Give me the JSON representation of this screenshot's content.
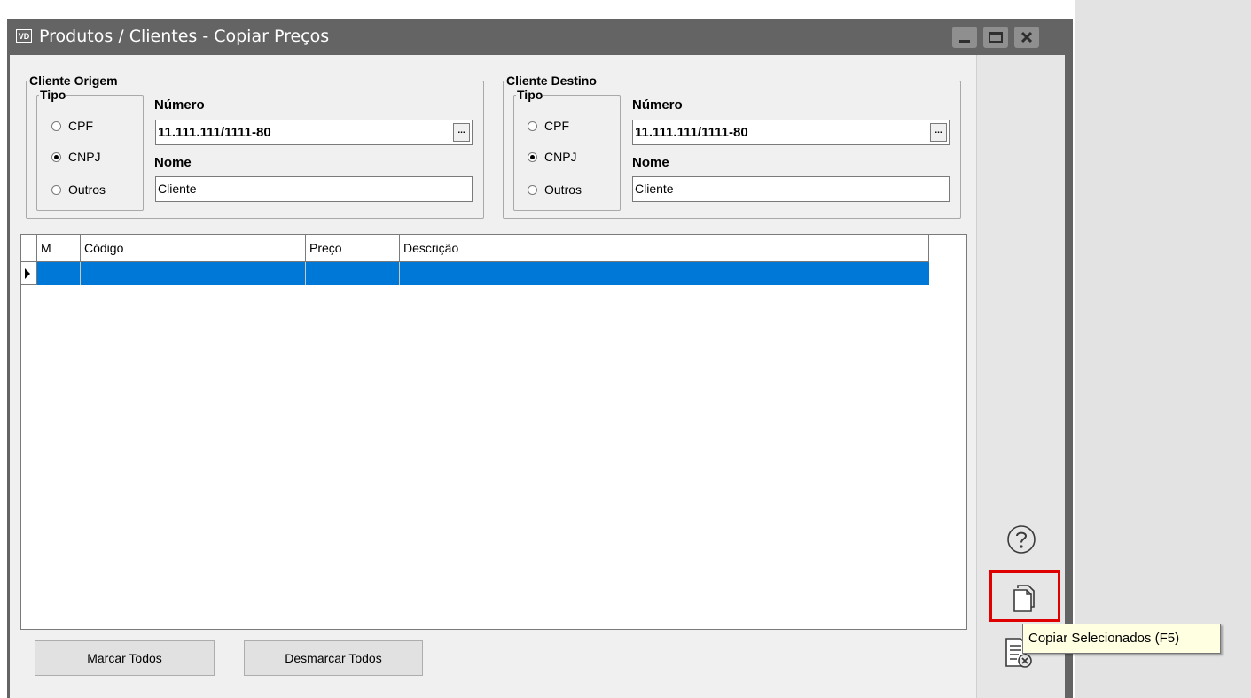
{
  "window": {
    "icon_text": "VD",
    "title": "Produtos / Clientes - Copiar Preços"
  },
  "origem": {
    "group_title": "Cliente Origem",
    "tipo_title": "Tipo",
    "tipo_options": [
      "CPF",
      "CNPJ",
      "Outros"
    ],
    "tipo_selected": "CNPJ",
    "numero_label": "Número",
    "numero_value": "11.111.111/1111-80",
    "nome_label": "Nome",
    "nome_value": "Cliente",
    "lookup_label": "..."
  },
  "destino": {
    "group_title": "Cliente Destino",
    "tipo_title": "Tipo",
    "tipo_options": [
      "CPF",
      "CNPJ",
      "Outros"
    ],
    "tipo_selected": "CNPJ",
    "numero_label": "Número",
    "numero_value": "11.111.111/1111-80",
    "nome_label": "Nome",
    "nome_value": "Cliente",
    "lookup_label": "..."
  },
  "grid": {
    "columns": [
      "M",
      "Código",
      "Preço",
      "Descrição"
    ],
    "selection_color": "#0078d7"
  },
  "buttons": {
    "marcar_todos": "Marcar Todos",
    "desmarcar_todos": "Desmarcar Todos"
  },
  "side_panel": {
    "icons": [
      "help-icon",
      "copy-document-icon",
      "cancel-document-icon"
    ],
    "highlight_color": "#e00000"
  },
  "tooltip": "Copiar Selecionados (F5)"
}
